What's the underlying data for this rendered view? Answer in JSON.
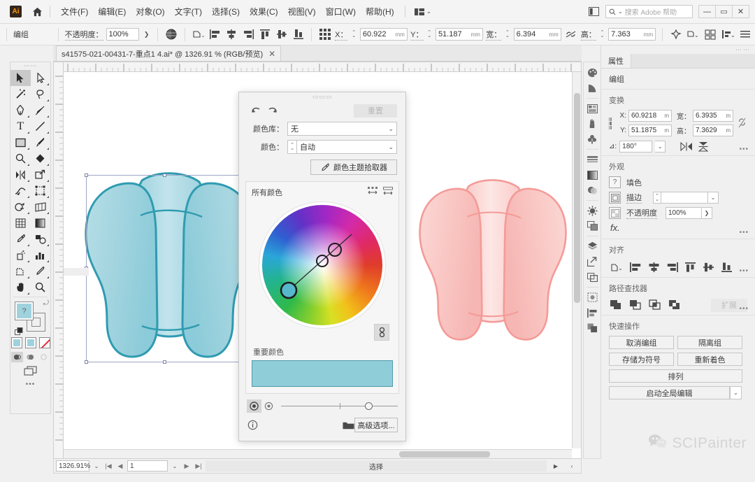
{
  "app": {
    "logo_text": "Ai",
    "home_icon": "home-icon",
    "workspace_icon": "workspace-switcher-icon"
  },
  "menubar": {
    "items": [
      {
        "label": "文件(F)"
      },
      {
        "label": "编辑(E)"
      },
      {
        "label": "对象(O)"
      },
      {
        "label": "文字(T)"
      },
      {
        "label": "选择(S)"
      },
      {
        "label": "效果(C)"
      },
      {
        "label": "视图(V)"
      },
      {
        "label": "窗口(W)"
      },
      {
        "label": "帮助(H)"
      }
    ],
    "search_placeholder": "搜索 Adobe 帮助",
    "window_buttons": {
      "minimize": "—",
      "maximize": "▭",
      "close": "✕"
    }
  },
  "controlbar": {
    "selection_label": "编组",
    "opacity_label": "不透明度：",
    "opacity_value": "100%",
    "x_label": "X：",
    "x_value": "60.922",
    "x_unit": "mm",
    "y_label": "Y：",
    "y_value": "51.187",
    "y_unit": "mm",
    "w_label": "宽：",
    "w_value": "6.394",
    "w_unit": "mm",
    "h_label": "高：",
    "h_value": "7.363",
    "h_unit": "mm",
    "icons": [
      "recolor-artwork-icon",
      "transform-icon",
      "align-left-icon",
      "align-center-h-icon",
      "align-right-icon",
      "align-top-icon",
      "align-middle-v-icon",
      "align-bottom-icon",
      "select-similar-icon",
      "isolate-icon",
      "arrange-icon",
      "preferences-icon"
    ]
  },
  "document_tab": {
    "title": "s41575-021-00431-7-重点1 4.ai* @ 1326.91 % (RGB/预览)",
    "close": "✕"
  },
  "toolbar": {
    "tools": [
      {
        "name": "selection-tool",
        "glyph": "➤",
        "active": true
      },
      {
        "name": "direct-selection-tool",
        "glyph": "▷",
        "active": false
      },
      {
        "name": "magic-wand-tool",
        "glyph": "✨",
        "active": false
      },
      {
        "name": "lasso-tool",
        "glyph": "🄾",
        "active": false
      },
      {
        "name": "pen-tool",
        "glyph": "✒",
        "active": false
      },
      {
        "name": "curvature-tool",
        "glyph": "✐",
        "active": false
      },
      {
        "name": "type-tool",
        "glyph": "T",
        "active": false
      },
      {
        "name": "line-segment-tool",
        "glyph": "╱",
        "active": false
      },
      {
        "name": "rectangle-tool",
        "glyph": "▢",
        "active": false
      },
      {
        "name": "paintbrush-tool",
        "glyph": "🖌",
        "active": false
      },
      {
        "name": "shaper-tool",
        "glyph": "◯",
        "active": false
      },
      {
        "name": "eraser-tool",
        "glyph": "◆",
        "active": false
      },
      {
        "name": "rotate-tool",
        "glyph": "⟳",
        "active": false
      },
      {
        "name": "scale-tool",
        "glyph": "⤢",
        "active": false
      },
      {
        "name": "width-tool",
        "glyph": "⌁",
        "active": false
      },
      {
        "name": "free-transform-tool",
        "glyph": "⛶",
        "active": false
      },
      {
        "name": "shape-builder-tool",
        "glyph": "◔",
        "active": false
      },
      {
        "name": "perspective-grid-tool",
        "glyph": "▱",
        "active": false
      },
      {
        "name": "mesh-tool",
        "glyph": "▩",
        "active": false
      },
      {
        "name": "gradient-tool",
        "glyph": "▤",
        "active": false
      },
      {
        "name": "eyedropper-tool",
        "glyph": "⚲",
        "active": false
      },
      {
        "name": "blend-tool",
        "glyph": "❧",
        "active": false
      },
      {
        "name": "symbol-sprayer-tool",
        "glyph": "⚘",
        "active": false
      },
      {
        "name": "column-graph-tool",
        "glyph": "▮",
        "active": false
      },
      {
        "name": "artboard-tool",
        "glyph": "▣",
        "active": false
      },
      {
        "name": "slice-tool",
        "glyph": "🔪",
        "active": false
      },
      {
        "name": "hand-tool",
        "glyph": "✋",
        "active": false
      },
      {
        "name": "zoom-tool",
        "glyph": "🔍",
        "active": false
      }
    ],
    "fill_color": "#9fd2dd",
    "stroke_color": "#ffffff",
    "color_modes": [
      "color-swatch-icon",
      "gradient-swatch-icon",
      "none-swatch-icon"
    ],
    "draw_modes": [
      "draw-normal-icon",
      "draw-behind-icon",
      "draw-inside-icon"
    ],
    "screen_mode": "screen-mode-icon",
    "more_tools": "•••"
  },
  "canvas": {
    "artwork_left": {
      "name": "teal-artwork",
      "fill_color": "#9fd2dd",
      "stroke_color": "#2f9bb0",
      "selected": true
    },
    "artwork_right": {
      "name": "pink-artwork",
      "fill_color": "#f8c3c0",
      "stroke_color": "#f09c9a",
      "selected": false
    }
  },
  "recolor_dialog": {
    "undo_icon": "undo-icon",
    "redo_icon": "redo-icon",
    "reset_label": "重置",
    "library_label": "颜色库：",
    "library_value": "无",
    "colors_label": "颜色：",
    "colors_value": "自动",
    "picker_label": "颜色主题拾取器",
    "picker_icon": "eyedropper-icon",
    "all_colors_label": "所有颜色",
    "wheel_icons": [
      "link-harmony-icon",
      "show-saturation-icon"
    ],
    "link_icon": "link-colors-icon",
    "significant_label": "重要颜色",
    "significant_color": "#8fcdd8",
    "slider_modes": [
      "wheel-mode-icon",
      "bar-mode-icon"
    ],
    "info_icon": "info-icon",
    "folder_icon": "folder-icon",
    "advanced_label": "高级选项..."
  },
  "dock": {
    "icons": [
      "color-panel-icon",
      "color-guide-icon",
      "libraries-panel-icon",
      "brushes-panel-icon",
      "symbols-panel-icon",
      "stroke-panel-icon",
      "gradient-panel-icon",
      "transparency-panel-icon",
      "appearance-panel-icon",
      "graphic-styles-icon",
      "layers-panel-icon",
      "export-panel-icon",
      "artboards-panel-icon",
      "image-trace-icon",
      "align-panel-icon",
      "pathfinder-panel-icon"
    ]
  },
  "properties": {
    "tab_label": "属性",
    "object_type": "编组",
    "transform": {
      "title": "变换",
      "x_label": "X:",
      "x_value": "60.9218",
      "x_unit": "m",
      "y_label": "Y:",
      "y_value": "51.1875",
      "y_unit": "m",
      "w_label": "宽：",
      "w_value": "6.3935",
      "w_unit": "m",
      "h_label": "高：",
      "h_value": "7.3629",
      "h_unit": "m",
      "angle_label": "⊿:",
      "angle_value": "180°",
      "lock_icon": "unlink-proportions-icon",
      "flip_h_icon": "flip-horizontal-icon",
      "flip_v_icon": "flip-vertical-icon",
      "more": "•••"
    },
    "appearance": {
      "title": "外观",
      "fill_label": "填色",
      "fill_swatch": "?",
      "stroke_label": "描边",
      "stroke_value": "",
      "opacity_label": "不透明度",
      "opacity_value": "100%",
      "fx_label": "fx.",
      "more": "•••"
    },
    "align": {
      "title": "对齐",
      "icons": [
        "align-to-selection-icon",
        "align-left-icon",
        "align-center-h-icon",
        "align-right-icon",
        "align-top-icon",
        "align-middle-v-icon",
        "align-bottom-icon"
      ],
      "more": "•••"
    },
    "pathfinder": {
      "title": "路径查找器",
      "icons": [
        "unite-icon",
        "minus-front-icon",
        "intersect-icon",
        "exclude-icon"
      ],
      "expand_label": "扩展",
      "more": "•••"
    },
    "quick_actions": {
      "title": "快速操作",
      "buttons": [
        {
          "label": "取消编组"
        },
        {
          "label": "隔离组"
        },
        {
          "label": "存储为符号"
        },
        {
          "label": "重新着色"
        },
        {
          "label": "排列"
        },
        {
          "label": "启动全局编辑"
        }
      ]
    }
  },
  "watermark": {
    "icon": "wechat-icon",
    "text": "SCIPainter"
  },
  "statusbar": {
    "zoom_value": "1326.91%",
    "first_page_icon": "first-page-icon",
    "prev_page_icon": "prev-page-icon",
    "page_value": "1",
    "next_page_icon": "next-page-icon",
    "last_page_icon": "last-page-icon",
    "status_text": "选择",
    "menu_icon": "status-menu-icon"
  }
}
